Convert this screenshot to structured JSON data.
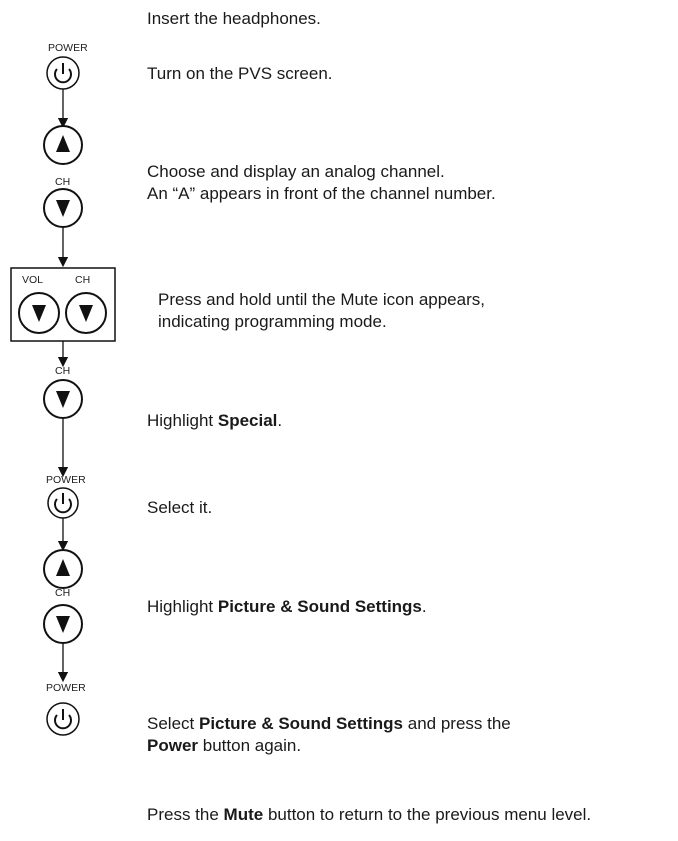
{
  "buttons": {
    "power_label": "POWER",
    "ch_label": "CH",
    "vol_label": "VOL"
  },
  "steps": [
    {
      "text": "Insert the headphones."
    },
    {
      "text": "Turn on the PVS screen."
    },
    {
      "line1": "Choose and display an analog channel.",
      "line2": "An “A” appears in front of the channel number."
    },
    {
      "line1": "Press and hold until the Mute icon appears,",
      "line2": "indicating programming mode."
    },
    {
      "prefix": "Highlight ",
      "bold": "Special",
      "suffix": "."
    },
    {
      "text": "Select it."
    },
    {
      "prefix": "Highlight ",
      "bold": "Picture & Sound Settings",
      "suffix": "."
    },
    {
      "prefix": "Select ",
      "bold": "Picture & Sound Settings",
      "mid": " and press the",
      "bold2": "Power",
      "suffix": " button again."
    },
    {
      "prefix": "Press the ",
      "bold": "Mute",
      "suffix": " button to return to the previous menu level."
    }
  ]
}
